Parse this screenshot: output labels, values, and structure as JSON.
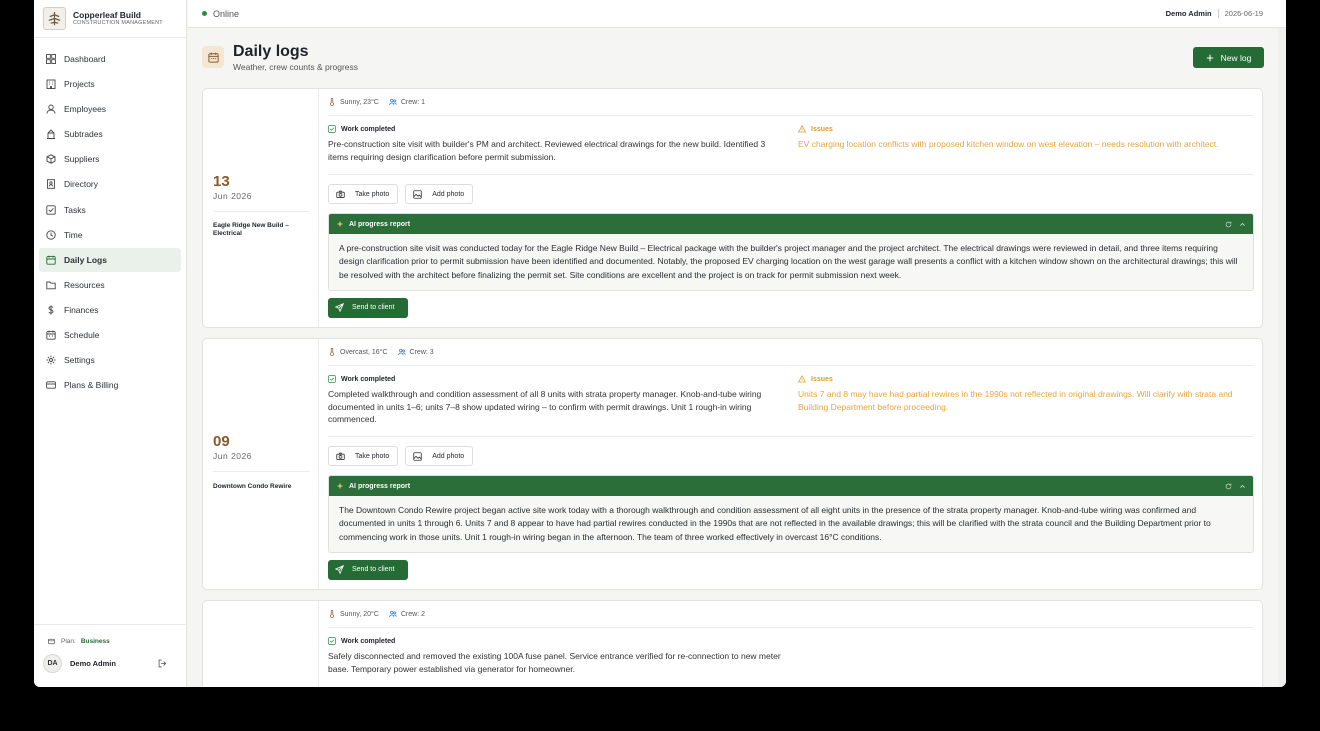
{
  "brand": {
    "name": "Copperleaf Build",
    "tagline": "CONSTRUCTION MANAGEMENT"
  },
  "nav": [
    {
      "label": "Dashboard",
      "icon": "grid-icon"
    },
    {
      "label": "Projects",
      "icon": "building-icon"
    },
    {
      "label": "Employees",
      "icon": "person-icon"
    },
    {
      "label": "Subtrades",
      "icon": "crane-icon"
    },
    {
      "label": "Suppliers",
      "icon": "box-icon"
    },
    {
      "label": "Directory",
      "icon": "contact-book-icon"
    },
    {
      "label": "Tasks",
      "icon": "checkbox-icon"
    },
    {
      "label": "Time",
      "icon": "clock-icon"
    },
    {
      "label": "Daily Logs",
      "icon": "calendar-icon",
      "active": true
    },
    {
      "label": "Resources",
      "icon": "folder-icon"
    },
    {
      "label": "Finances",
      "icon": "dollar-icon"
    },
    {
      "label": "Schedule",
      "icon": "schedule-icon"
    },
    {
      "label": "Settings",
      "icon": "gear-icon"
    },
    {
      "label": "Plans & Billing",
      "icon": "credit-card-icon"
    }
  ],
  "plan": {
    "label": "Plan:",
    "value": "Business"
  },
  "user": {
    "initials": "DA",
    "name": "Demo Admin"
  },
  "topbar": {
    "status": "Online",
    "user": "Demo Admin",
    "date": "2026-06-19"
  },
  "page": {
    "title": "Daily logs",
    "subtitle": "Weather, crew counts & progress",
    "new_button": "New log"
  },
  "labels": {
    "work_completed": "Work completed",
    "issues": "Issues",
    "take_photo": "Take photo",
    "add_photo": "Add photo",
    "ai_report": "AI progress report",
    "send_to_client": "Send to client"
  },
  "logs": [
    {
      "day": "13",
      "month": "Jun 2026",
      "project": "Eagle Ridge New Build – Electrical",
      "weather": "Sunny, 23°C",
      "crew": "Crew: 1",
      "work": "Pre-construction site visit with builder's PM and architect. Reviewed electrical drawings for the new build. Identified 3 items requiring design clarification before permit submission.",
      "issues": "EV charging location conflicts with proposed kitchen window on west elevation – needs resolution with architect.",
      "ai": "A pre-construction site visit was conducted today for the Eagle Ridge New Build – Electrical package with the builder's project manager and the project architect. The electrical drawings were reviewed in detail, and three items requiring design clarification prior to permit submission have been identified and documented. Notably, the proposed EV charging location on the west garage wall presents a conflict with a kitchen window shown on the architectural drawings; this will be resolved with the architect before finalizing the permit set. Site conditions are excellent and the project is on track for permit submission next week."
    },
    {
      "day": "09",
      "month": "Jun 2026",
      "project": "Downtown Condo Rewire",
      "weather": "Overcast, 16°C",
      "crew": "Crew: 3",
      "work": "Completed walkthrough and condition assessment of all 8 units with strata property manager. Knob-and-tube wiring documented in units 1–6; units 7–8 show updated wiring – to confirm with permit drawings. Unit 1 rough-in wiring commenced.",
      "issues": "Units 7 and 8 may have had partial rewires in the 1990s not reflected in original drawings. Will clarify with strata and Building Department before proceeding.",
      "ai": "The Downtown Condo Rewire project began active site work today with a thorough walkthrough and condition assessment of all eight units in the presence of the strata property manager. Knob-and-tube wiring was confirmed and documented in units 1 through 6. Units 7 and 8 appear to have had partial rewires conducted in the 1990s that are not reflected in the available drawings; this will be clarified with the strata council and the Building Department prior to commencing work in those units. Unit 1 rough-in wiring began in the afternoon. The team of three worked effectively in overcast 16°C conditions."
    },
    {
      "day": "",
      "month": "",
      "project": "",
      "weather": "Sunny, 20°C",
      "crew": "Crew: 2",
      "work": "Safely disconnected and removed the existing 100A fuse panel. Service entrance verified for re-connection to new meter base. Temporary power established via generator for homeowner.",
      "issues": "",
      "ai": ""
    }
  ],
  "colors": {
    "accent": "#256b35",
    "issue": "#e09a2a",
    "date": "#8a5a2b"
  }
}
